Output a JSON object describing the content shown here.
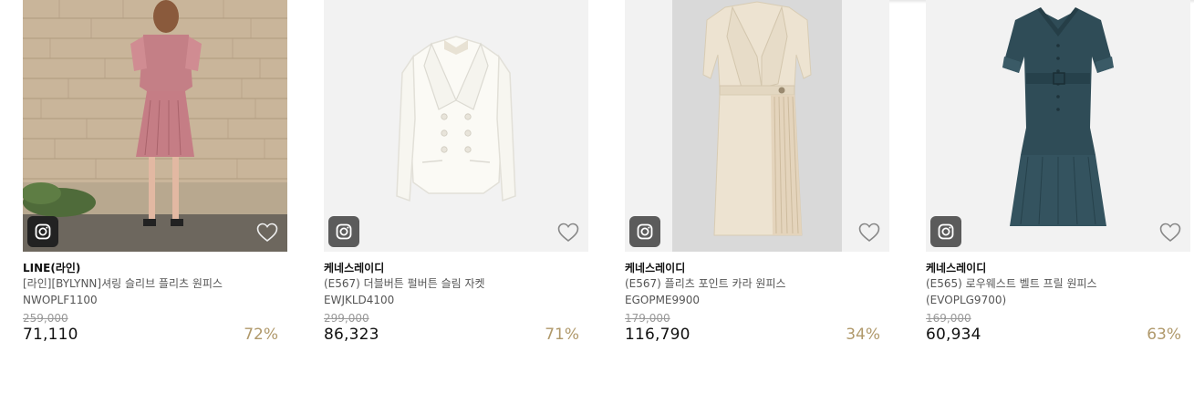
{
  "products": [
    {
      "brand": "LINE(라인)",
      "name": "[라인][BYLYNN]셔링 슬리브 플리츠 원피스",
      "code": "NWOPLF1100",
      "original_price": "259,000",
      "price": "71,110",
      "discount": "72%",
      "image": "woman-pink-dress-brick-wall",
      "instagram_icon": "instagram-icon",
      "wishlist_icon": "heart-icon"
    },
    {
      "brand": "케네스레이디",
      "name": "(E567) 더블버튼 펄버튼 슬림 자켓",
      "code": "EWJKLD4100",
      "original_price": "299,000",
      "price": "86,323",
      "discount": "71%",
      "image": "ivory-double-button-jacket",
      "instagram_icon": "instagram-icon",
      "wishlist_icon": "heart-icon"
    },
    {
      "brand": "케네스레이디",
      "name": "(E567) 플리츠 포인트 카라 원피스",
      "code": "EGOPME9900",
      "original_price": "179,000",
      "price": "116,790",
      "discount": "34%",
      "image": "beige-collar-pleated-dress",
      "instagram_icon": "instagram-icon",
      "wishlist_icon": "heart-icon"
    },
    {
      "brand": "케네스레이디",
      "name": "(E565) 로우웨스트 벨트 프릴 원피스",
      "code": "(EVOPLG9700)",
      "original_price": "169,000",
      "price": "60,934",
      "discount": "63%",
      "image": "teal-belted-frill-dress",
      "instagram_icon": "instagram-icon",
      "wishlist_icon": "heart-icon"
    }
  ],
  "colors": {
    "discount": "#b0996b",
    "price": "#111111",
    "original_price": "#999999"
  }
}
